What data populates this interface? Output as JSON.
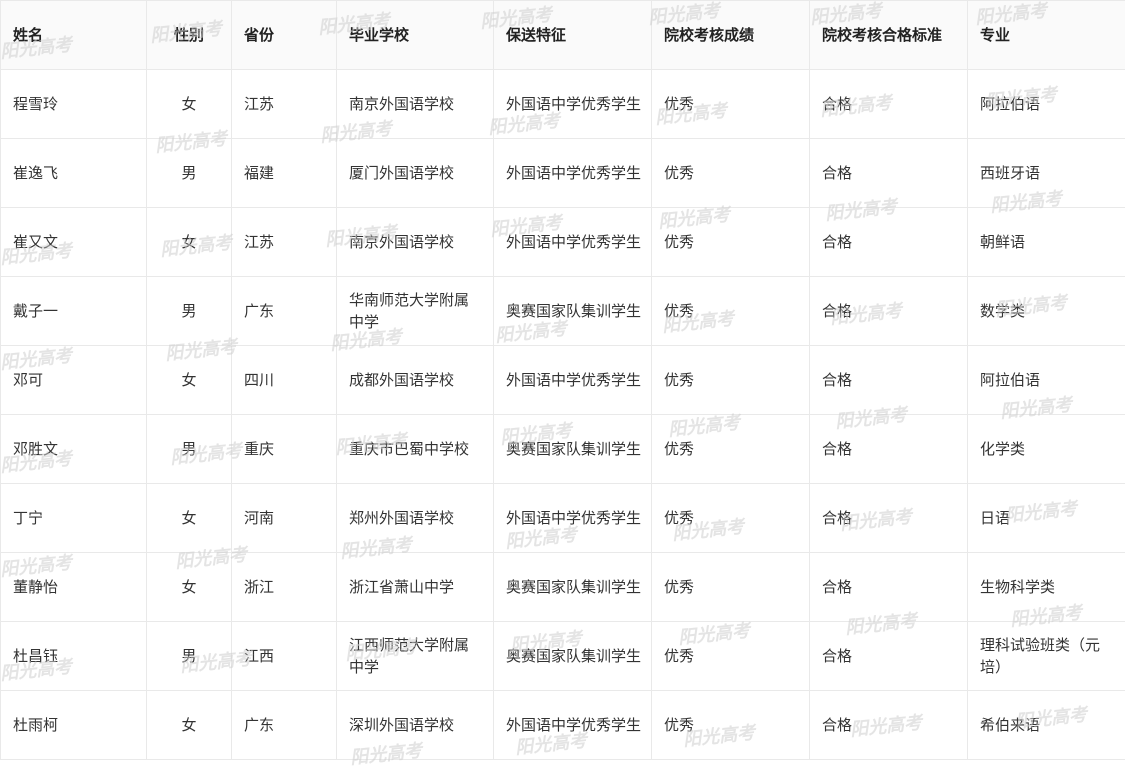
{
  "table": {
    "headers": [
      "姓名",
      "性别",
      "省份",
      "毕业学校",
      "保送特征",
      "院校考核成绩",
      "院校考核合格标准",
      "专业"
    ],
    "rows": [
      [
        "程雪玲",
        "女",
        "江苏",
        "南京外国语学校",
        "外国语中学优秀学生",
        "优秀",
        "合格",
        "阿拉伯语"
      ],
      [
        "崔逸飞",
        "男",
        "福建",
        "厦门外国语学校",
        "外国语中学优秀学生",
        "优秀",
        "合格",
        "西班牙语"
      ],
      [
        "崔又文",
        "女",
        "江苏",
        "南京外国语学校",
        "外国语中学优秀学生",
        "优秀",
        "合格",
        "朝鲜语"
      ],
      [
        "戴子一",
        "男",
        "广东",
        "华南师范大学附属中学",
        "奥赛国家队集训学生",
        "优秀",
        "合格",
        "数学类"
      ],
      [
        "邓可",
        "女",
        "四川",
        "成都外国语学校",
        "外国语中学优秀学生",
        "优秀",
        "合格",
        "阿拉伯语"
      ],
      [
        "邓胜文",
        "男",
        "重庆",
        "重庆市巴蜀中学校",
        "奥赛国家队集训学生",
        "优秀",
        "合格",
        "化学类"
      ],
      [
        "丁宁",
        "女",
        "河南",
        "郑州外国语学校",
        "外国语中学优秀学生",
        "优秀",
        "合格",
        "日语"
      ],
      [
        "董静怡",
        "女",
        "浙江",
        "浙江省萧山中学",
        "奥赛国家队集训学生",
        "优秀",
        "合格",
        "生物科学类"
      ],
      [
        "杜昌钰",
        "男",
        "江西",
        "江西师范大学附属中学",
        "奥赛国家队集训学生",
        "优秀",
        "合格",
        "理科试验班类（元培）"
      ],
      [
        "杜雨柯",
        "女",
        "广东",
        "深圳外国语学校",
        "外国语中学优秀学生",
        "优秀",
        "合格",
        "希伯来语"
      ]
    ]
  },
  "watermark": {
    "text": "阳光高考"
  }
}
